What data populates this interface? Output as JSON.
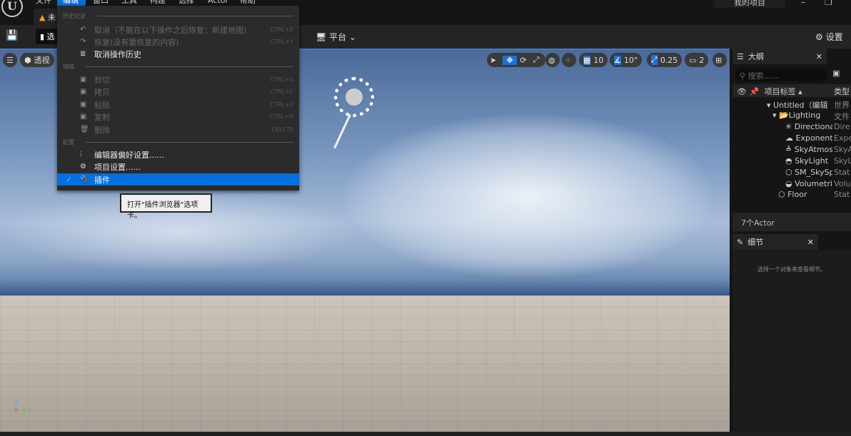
{
  "menubar": [
    "文件",
    "编辑",
    "窗口",
    "工具",
    "构建",
    "选择",
    "Actor",
    "帮助"
  ],
  "tab_label": "未",
  "my_project": "我的项目",
  "toolbar": {
    "mode": "选",
    "platform": "平台",
    "settings": "设置"
  },
  "viewport": {
    "menu_icon": "hamburger-icon",
    "view_mode": "透视",
    "grid_snap": "10",
    "rotation_snap": "10°",
    "scale_snap": "0.25",
    "camera_speed": "2"
  },
  "edit_menu": {
    "sections": [
      "历史记录",
      "编辑",
      "配置"
    ],
    "items": [
      {
        "label": "取消（不能在以下操作之后恢复：新建地图）",
        "shortcut": "CTRL+Z",
        "icon": "↶"
      },
      {
        "label": "恢复(没有要恢复的内容)",
        "shortcut": "CTRL+Y",
        "icon": "↷"
      },
      {
        "label": "取消操作历史",
        "shortcut": "",
        "icon": "≣"
      },
      {
        "label": "剪切",
        "shortcut": "CTRL+X",
        "icon": "▣"
      },
      {
        "label": "拷贝",
        "shortcut": "CTRL+C",
        "icon": "▣"
      },
      {
        "label": "粘贴",
        "shortcut": "CTRL+V",
        "icon": "▣"
      },
      {
        "label": "复制",
        "shortcut": "CTRL+D",
        "icon": "▣"
      },
      {
        "label": "删除",
        "shortcut": "DELETE",
        "icon": "🗑"
      },
      {
        "label": "编辑器偏好设置......",
        "shortcut": "",
        "icon": "⫶"
      },
      {
        "label": "项目设置......",
        "shortcut": "",
        "icon": "⚙"
      },
      {
        "label": "插件",
        "shortcut": "",
        "icon": "🔌"
      }
    ]
  },
  "tooltip": "打开\"插件浏览器\"选项卡。",
  "outliner": {
    "title": "大纲",
    "search_placeholder": "搜索......",
    "col_label": "项目标签 ▴",
    "col_type": "类型",
    "rows": [
      {
        "name": "Untitled（编辑",
        "type": "世界"
      },
      {
        "name": "Lighting",
        "type": "文件"
      },
      {
        "name": "Directional",
        "type": "Dire"
      },
      {
        "name": "Exponenti",
        "type": "Expo"
      },
      {
        "name": "SkyAtmos",
        "type": "SkyA"
      },
      {
        "name": "SkyLight",
        "type": "SkyL"
      },
      {
        "name": "SM_SkySp",
        "type": "Stat"
      },
      {
        "name": "Volumetri",
        "type": "Volu"
      },
      {
        "name": "Floor",
        "type": "Stat"
      }
    ],
    "count": "7个Actor"
  },
  "details": {
    "title": "细节",
    "empty": "选择一个对象来查看细节。"
  }
}
